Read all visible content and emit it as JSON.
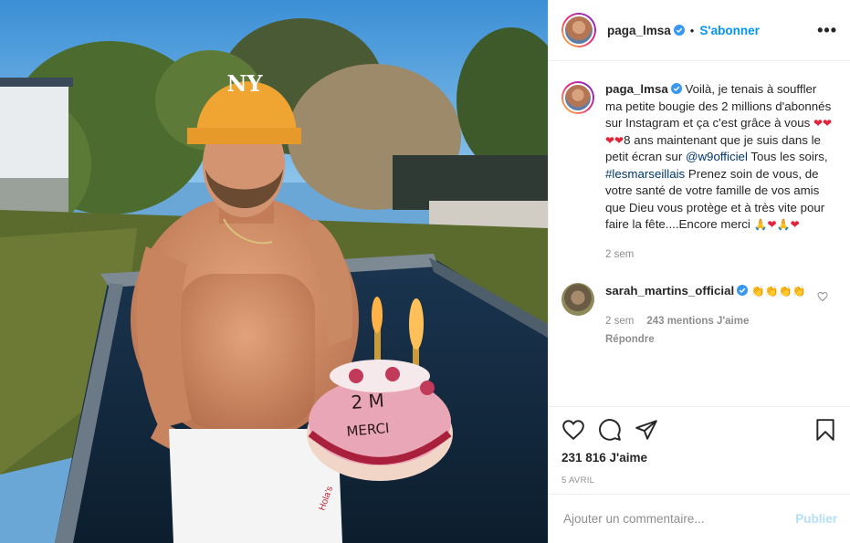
{
  "header": {
    "username": "paga_lmsa",
    "separator": "•",
    "follow_label": "S'abonner",
    "more_label": "•••"
  },
  "caption": {
    "username": "paga_lmsa",
    "text_1": "Voilà, je tenais à souffler ma petite bougie des 2 millions d'abonnés sur Instagram et ça c'est grâce à vous ",
    "hearts_1": "❤❤❤❤",
    "text_2": "8 ans maintenant que je suis dans le petit écran sur ",
    "mention": "@w9officiel",
    "text_3": " Tous les soirs, ",
    "hashtag": "#lesmarseillais",
    "text_4": " Prenez soin de vous, de votre santé de votre famille de vos amis que Dieu vous protège et à très vite pour faire la fête....Encore merci ",
    "emojis_end_1": "🙏",
    "emojis_end_2": "❤",
    "emojis_end_3": "🙏",
    "emojis_end_4": "❤",
    "time": "2 sem"
  },
  "comment": {
    "username": "sarah_martins_official",
    "emojis": "👏👏👏👏",
    "time": "2 sem",
    "likes": "243 mentions J'aime",
    "reply_label": "Répondre"
  },
  "actions": {
    "likes_count": "231 816 J'aime",
    "date": "5 AVRIL"
  },
  "add_comment": {
    "placeholder": "Ajouter un commentaire...",
    "publish_label": "Publier"
  },
  "photo": {
    "cake_line_1": "2 M",
    "cake_line_2": "MERCI",
    "cap_logo": "NY",
    "shorts_text": "Hola's"
  },
  "colors": {
    "accent": "#0095f6",
    "verified": "#3897f0",
    "link": "#00376b",
    "secondary_text": "#8e8e8e",
    "publish_disabled": "#b2dffc"
  }
}
